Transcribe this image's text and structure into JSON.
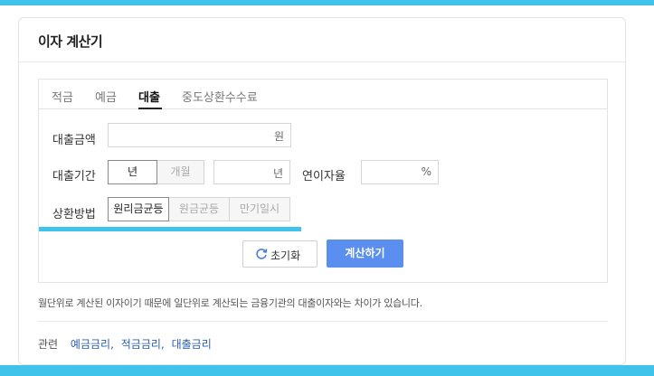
{
  "colors": {
    "accent_bar": "#3fc3ea",
    "primary_button": "#5a8ff0",
    "link": "#2a5db0"
  },
  "card": {
    "title": "이자 계산기"
  },
  "tabs": [
    {
      "label": "적금",
      "active": false
    },
    {
      "label": "예금",
      "active": false
    },
    {
      "label": "대출",
      "active": true
    },
    {
      "label": "중도상환수수료",
      "active": false
    }
  ],
  "form": {
    "loan_amount": {
      "label": "대출금액",
      "value": "",
      "unit": "원"
    },
    "loan_period": {
      "label": "대출기간",
      "options": [
        {
          "label": "년",
          "active": true
        },
        {
          "label": "개월",
          "active": false
        }
      ],
      "value": "",
      "unit": "년"
    },
    "annual_rate": {
      "label": "연이자율",
      "value": "",
      "unit": "%"
    },
    "repayment": {
      "label": "상환방법",
      "options": [
        {
          "label": "원리금균등",
          "active": true
        },
        {
          "label": "원금균등",
          "active": false
        },
        {
          "label": "만기일시",
          "active": false
        }
      ]
    }
  },
  "buttons": {
    "reset_label": "초기화",
    "reset_icon": "refresh-icon",
    "calc_label": "계산하기"
  },
  "note": "월단위로 계산된 이자이기 때문에 일단위로 계산되는 금융기관의 대출이자와는 차이가 있습니다.",
  "related": {
    "label": "관련",
    "links": [
      "예금금리",
      "적금금리",
      "대출금리"
    ],
    "separator": ","
  }
}
